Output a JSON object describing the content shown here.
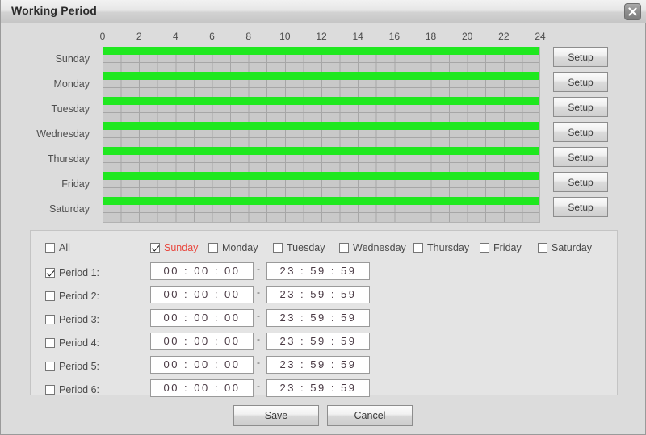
{
  "window": {
    "title": "Working Period",
    "close_icon": "close-icon"
  },
  "schedule": {
    "hour_ticks": [
      "0",
      "2",
      "4",
      "6",
      "8",
      "10",
      "12",
      "14",
      "16",
      "18",
      "20",
      "22",
      "24"
    ],
    "hours_total": 24,
    "green_color": "#1fe81f",
    "grid_color": "#c9c9c9",
    "days": [
      {
        "label": "Sunday",
        "setup_label": "Setup",
        "covered_start": 0,
        "covered_end": 24
      },
      {
        "label": "Monday",
        "setup_label": "Setup",
        "covered_start": 0,
        "covered_end": 24
      },
      {
        "label": "Tuesday",
        "setup_label": "Setup",
        "covered_start": 0,
        "covered_end": 24
      },
      {
        "label": "Wednesday",
        "setup_label": "Setup",
        "covered_start": 0,
        "covered_end": 24
      },
      {
        "label": "Thursday",
        "setup_label": "Setup",
        "covered_start": 0,
        "covered_end": 24
      },
      {
        "label": "Friday",
        "setup_label": "Setup",
        "covered_start": 0,
        "covered_end": 24
      },
      {
        "label": "Saturday",
        "setup_label": "Setup",
        "covered_start": 0,
        "covered_end": 24
      }
    ]
  },
  "panel": {
    "all": {
      "label": "All",
      "checked": false
    },
    "days": [
      {
        "label": "Sunday",
        "checked": true,
        "highlight": true
      },
      {
        "label": "Monday",
        "checked": false,
        "highlight": false
      },
      {
        "label": "Tuesday",
        "checked": false,
        "highlight": false
      },
      {
        "label": "Wednesday",
        "checked": false,
        "highlight": false
      },
      {
        "label": "Thursday",
        "checked": false,
        "highlight": false
      },
      {
        "label": "Friday",
        "checked": false,
        "highlight": false
      },
      {
        "label": "Saturday",
        "checked": false,
        "highlight": false
      }
    ],
    "separator": "-",
    "periods": [
      {
        "label": "Period 1:",
        "checked": true,
        "start": "00 : 00 : 00",
        "end": "23 : 59 : 59"
      },
      {
        "label": "Period 2:",
        "checked": false,
        "start": "00 : 00 : 00",
        "end": "23 : 59 : 59"
      },
      {
        "label": "Period 3:",
        "checked": false,
        "start": "00 : 00 : 00",
        "end": "23 : 59 : 59"
      },
      {
        "label": "Period 4:",
        "checked": false,
        "start": "00 : 00 : 00",
        "end": "23 : 59 : 59"
      },
      {
        "label": "Period 5:",
        "checked": false,
        "start": "00 : 00 : 00",
        "end": "23 : 59 : 59"
      },
      {
        "label": "Period 6:",
        "checked": false,
        "start": "00 : 00 : 00",
        "end": "23 : 59 : 59"
      }
    ]
  },
  "footer": {
    "save_label": "Save",
    "cancel_label": "Cancel"
  }
}
